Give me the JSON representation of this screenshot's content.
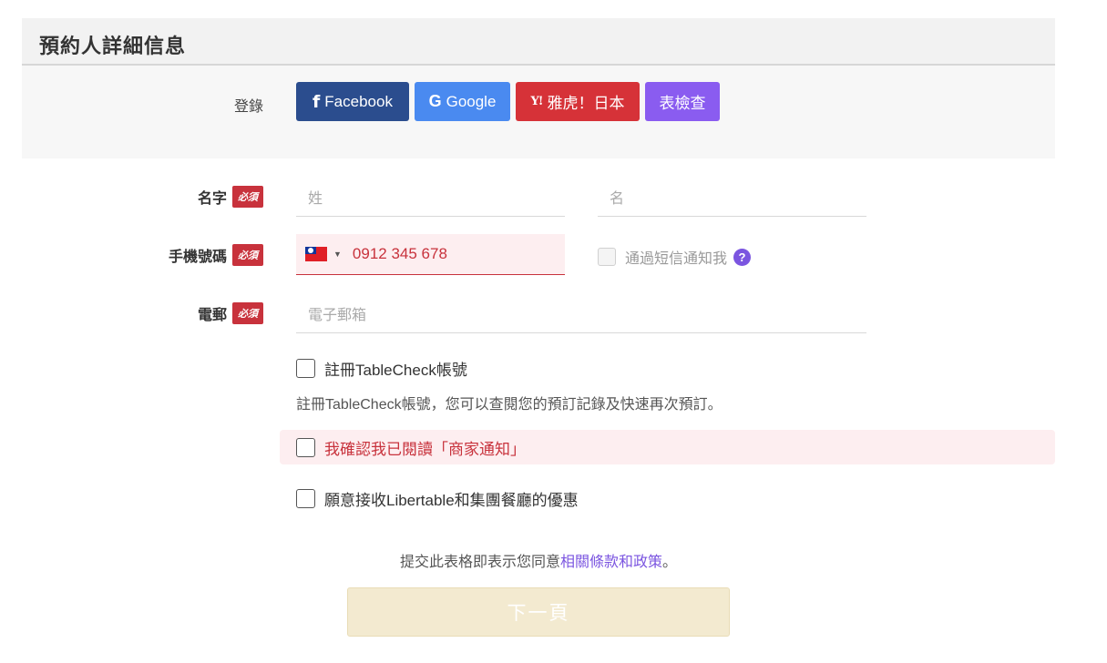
{
  "header": {
    "title": "預約人詳細信息"
  },
  "login": {
    "label": "登錄",
    "buttons": {
      "facebook": {
        "icon": "facebook-icon",
        "label": "Facebook",
        "color": "#2b4d8e"
      },
      "google": {
        "icon": "google-icon",
        "label": "Google",
        "color": "#4a8af0"
      },
      "yahoo": {
        "icon": "yahoo-icon",
        "label": "雅虎！日本",
        "color": "#d63238"
      },
      "tablecheck": {
        "label": "表檢查",
        "color": "#8a5cf0"
      }
    }
  },
  "required_badge": "必須",
  "name": {
    "label": "名字",
    "lastname_placeholder": "姓",
    "firstname_placeholder": "名"
  },
  "phone": {
    "label": "手機號碼",
    "country_flag": "taiwan-flag-icon",
    "value": "0912 345 678",
    "sms_label": "通過短信通知我"
  },
  "email": {
    "label": "電郵",
    "placeholder": "電子郵箱"
  },
  "options": {
    "register_label": "註冊TableCheck帳號",
    "register_desc": "註冊TableCheck帳號，您可以查閱您的預訂記錄及快速再次預訂。",
    "notice_label": "我確認我已閱讀「商家通知」",
    "promo_label": "願意接收Libertable和集團餐廳的優惠"
  },
  "terms": {
    "prefix": "提交此表格即表示您同意",
    "link": "相關條款和政策",
    "suffix": "。"
  },
  "next_button": "下一頁",
  "colors": {
    "required": "#c8323c",
    "accent": "#7b55e0",
    "next_disabled": "#f3ead0"
  }
}
